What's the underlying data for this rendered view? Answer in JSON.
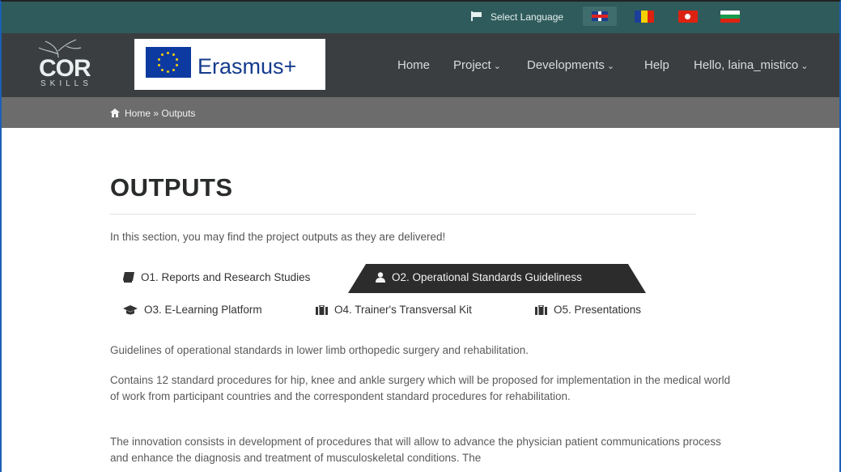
{
  "lang_bar": {
    "select_language": "Select Language"
  },
  "header": {
    "logo_text": "COR",
    "logo_sub": "SKILLS",
    "erasmus_text": "Erasmus+",
    "nav": [
      {
        "label": "Home"
      },
      {
        "label": "Project",
        "chevron": "⌄"
      },
      {
        "label": "Developments",
        "chevron": "⌄"
      },
      {
        "label": "Help"
      },
      {
        "label": "Hello, laina_mistico",
        "chevron": "⌄"
      }
    ]
  },
  "breadcrumb": {
    "home": "Home",
    "separator": "»",
    "current": "Outputs"
  },
  "page": {
    "title": "OUTPUTS",
    "intro": "In this section, you may find the project outputs as they are delivered!"
  },
  "tabs": [
    {
      "label": "O1. Reports and Research Studies",
      "icon": "book-icon",
      "active": false
    },
    {
      "label": "O2. Operational Standards Guideliness",
      "icon": "user-icon",
      "active": true
    },
    {
      "label": "O3. E-Learning Platform",
      "icon": "graduation-cap-icon",
      "active": false
    },
    {
      "label": "O4. Trainer's Transversal Kit",
      "icon": "briefcase-icon",
      "active": false
    },
    {
      "label": "O5. Presentations",
      "icon": "briefcase-icon",
      "active": false
    }
  ],
  "content": {
    "p1": "Guidelines of operational standards in lower limb orthopedic surgery and rehabilitation.",
    "p2": "Contains 12 standard procedures for hip, knee and ankle surgery which will be proposed for implementation in the medical world of work from participant countries and the correspondent standard procedures for rehabilitation.",
    "p3": "The innovation consists in development of procedures that will allow to advance the physician patient communications process and enhance the diagnosis and treatment of musculoskeletal conditions. The"
  },
  "colors": {
    "lang_bar": "#2f5b5c",
    "header": "#3b3e40",
    "breadcrumb_bar": "#6c6c6c",
    "active_tab": "#2c2c2c"
  }
}
